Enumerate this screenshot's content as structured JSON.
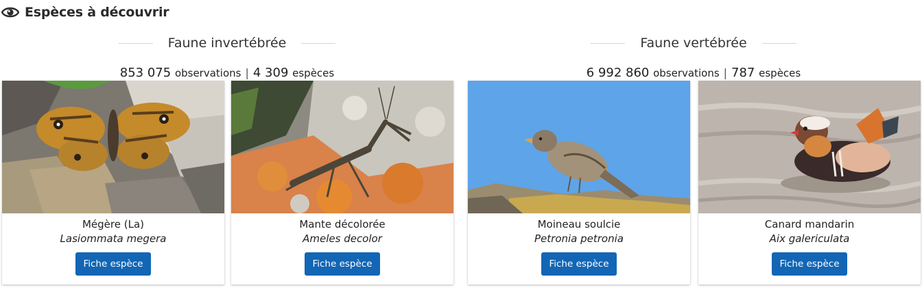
{
  "section": {
    "title": "Espèces à découvrir",
    "icon": "eye-icon"
  },
  "groups": [
    {
      "title": "Faune invertébrée",
      "observations": "853 075",
      "observations_label": "observations",
      "separator": "|",
      "species_count": "4 309",
      "species_label": "espèces",
      "cards": [
        {
          "common_name": "Mégère (La)",
          "latin_name": "Lasiommata megera",
          "button": "Fiche espèce",
          "credit": ""
        },
        {
          "common_name": "Mante décolorée",
          "latin_name": "Ameles decolor",
          "button": "Fiche espèce",
          "credit": ""
        }
      ]
    },
    {
      "title": "Faune vertébrée",
      "observations": "6 992 860",
      "observations_label": "observations",
      "separator": "|",
      "species_count": "787",
      "species_label": "espèces",
      "cards": [
        {
          "common_name": "Moineau soulcie",
          "latin_name": "Petronia petronia",
          "button": "Fiche espèce",
          "credit": ""
        },
        {
          "common_name": "Canard mandarin",
          "latin_name": "Aix galericulata",
          "button": "Fiche espèce",
          "credit": ""
        }
      ]
    }
  ],
  "colors": {
    "button": "#1266b5",
    "sky": "#5ea4e8"
  }
}
